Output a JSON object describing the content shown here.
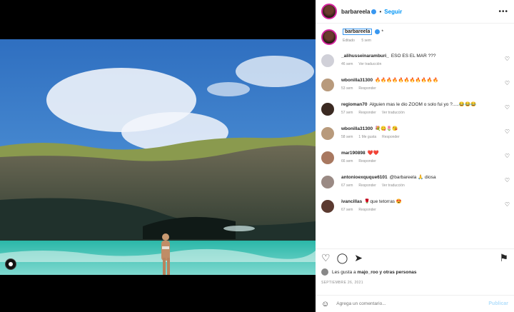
{
  "header": {
    "username": "barbareela",
    "separator": "•",
    "follow_label": "Seguir",
    "more_icon": "more-dots-icon"
  },
  "caption": {
    "username": "barbareela",
    "text": "*",
    "age": "5 sem",
    "edited": "Editado"
  },
  "comments": [
    {
      "user": "_alihusseinaramburi_",
      "text": "ESO ES EL MAR ???",
      "age": "46 sem",
      "action1": "Ver traducción",
      "action2": ""
    },
    {
      "user": "wbonilla31300",
      "text": "🔥🔥🔥🔥🔥🔥🔥🔥🔥🔥🔥",
      "age": "53 sem",
      "action1": "Responder",
      "action2": ""
    },
    {
      "user": "regioman70",
      "text": "Alguien mas le dio ZOOM o solo fui yo ?.....😂😂😂",
      "age": "57 sem",
      "action1": "Responder",
      "action2": "Ver traducción"
    },
    {
      "user": "wbonilla31300",
      "text": "💐😋🌷😘",
      "age": "58 sem",
      "action1": "1 Me gusta",
      "action2": "Responder"
    },
    {
      "user": "mar190898",
      "text": "❤️❤️",
      "age": "66 sem",
      "action1": "Responder",
      "action2": ""
    },
    {
      "user": "antonioexquque6101",
      "text": "@barbareela 🙏 diosa",
      "age": "67 sem",
      "action1": "Responder",
      "action2": "Ver traducción"
    },
    {
      "user": "ivancillas",
      "text": "🌹que tetorras 😍",
      "age": "67 sem",
      "action1": "Responder",
      "action2": ""
    }
  ],
  "likes": {
    "prefix": "Les gusta a",
    "user": "majo_roo",
    "suffix": "y otras personas"
  },
  "date": "SEPTIEMBRE 26, 2021",
  "add_comment": {
    "placeholder": "Agrega un comentario...",
    "publish_label": "Publicar"
  },
  "colors": {
    "accent": "#0095f6",
    "text": "#262626",
    "muted": "#8e8e8e",
    "publish_disabled": "#b2dffc"
  }
}
